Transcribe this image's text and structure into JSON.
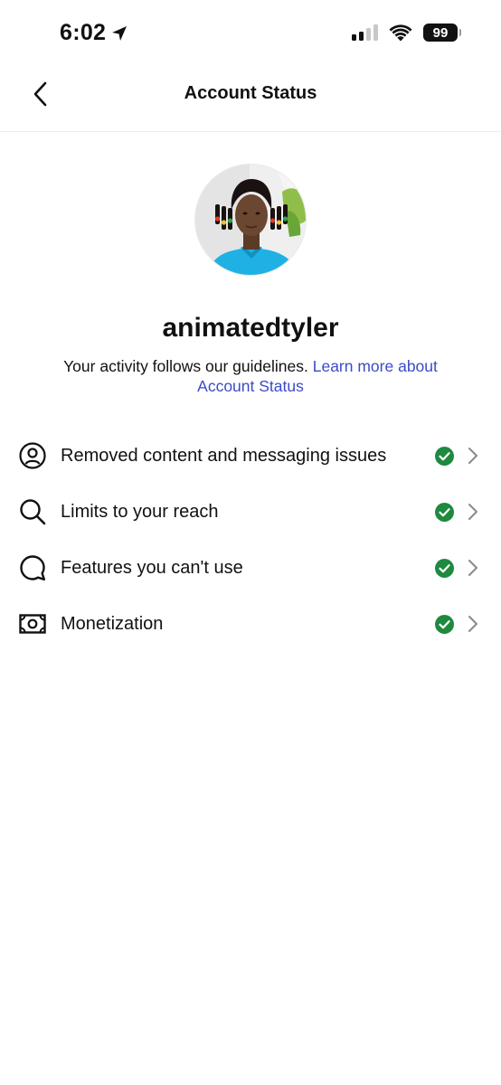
{
  "status_bar": {
    "time": "6:02",
    "battery": "99"
  },
  "header": {
    "title": "Account Status",
    "back_icon": "chevron-left-icon"
  },
  "profile": {
    "username": "animatedtyler",
    "message": "Your activity follows our guidelines.",
    "learn_more_link": "Learn more about Account Status"
  },
  "status_items": [
    {
      "label": "Removed content and messaging issues",
      "icon": "person-circle-icon",
      "status": "ok"
    },
    {
      "label": "Limits to your reach",
      "icon": "magnifier-icon",
      "status": "ok"
    },
    {
      "label": "Features you can't use",
      "icon": "speech-bubble-icon",
      "status": "ok"
    },
    {
      "label": "Monetization",
      "icon": "cash-icon",
      "status": "ok"
    }
  ],
  "colors": {
    "link": "#3b4bc7",
    "ok_green": "#1e8a3f",
    "chevron": "#8a8a8a"
  }
}
